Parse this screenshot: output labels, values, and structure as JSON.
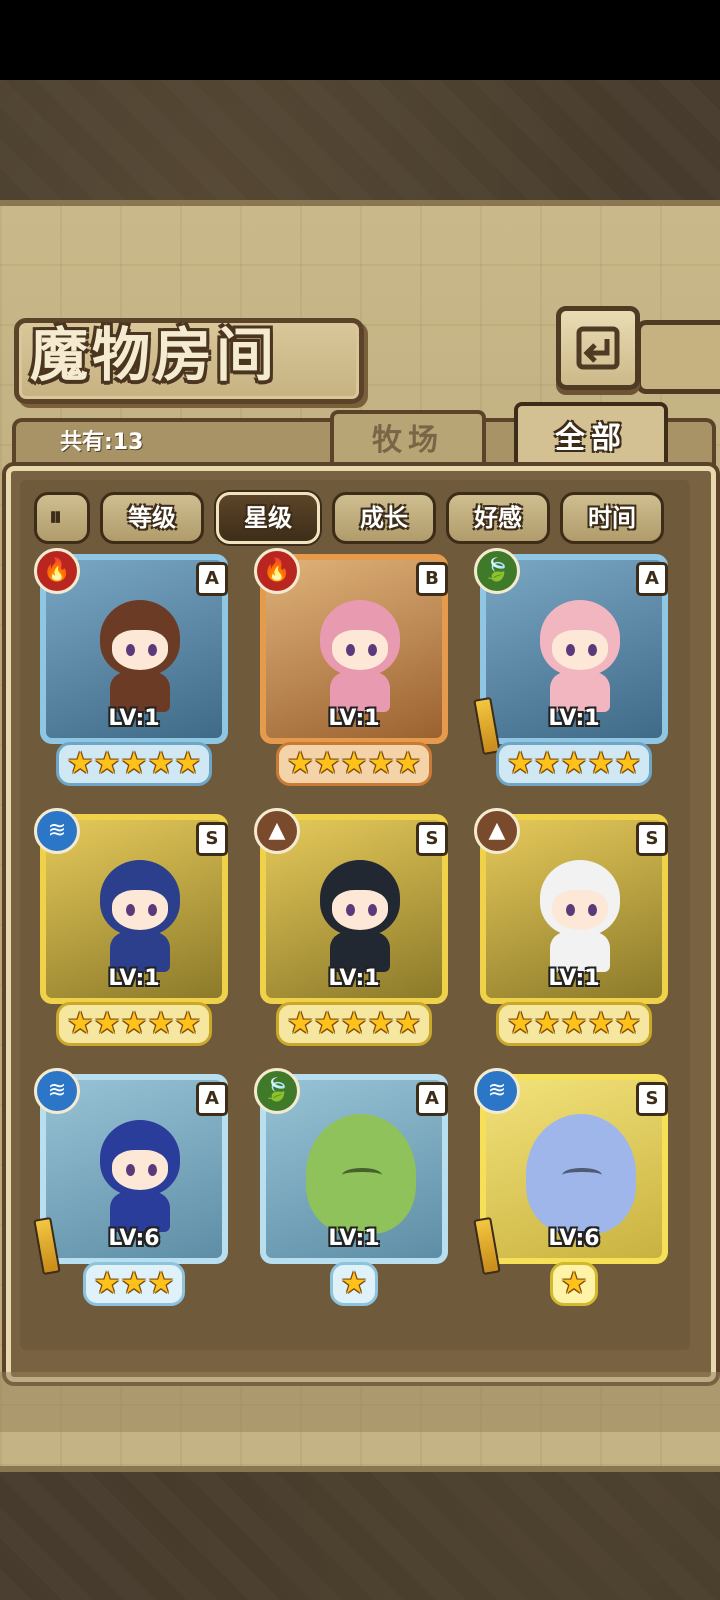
{
  "header": {
    "title": "魔物房间",
    "back_icon": "back-arrow-icon"
  },
  "tabs": {
    "count_label": "共有:13",
    "ranch": "牧场",
    "all": "全部",
    "active": "all"
  },
  "sort": {
    "toggle_icon": "sort-order-icon",
    "buttons": [
      "等级",
      "星级",
      "成长",
      "好感",
      "时间"
    ],
    "active": "星级"
  },
  "monsters": [
    {
      "element": "fire",
      "rank": "A",
      "level": "LV:1",
      "stars": 5,
      "frame": "blue"
    },
    {
      "element": "fire",
      "rank": "B",
      "level": "LV:1",
      "stars": 5,
      "frame": "orange"
    },
    {
      "element": "grass",
      "rank": "A",
      "level": "LV:1",
      "stars": 5,
      "frame": "blue"
    },
    {
      "element": "water",
      "rank": "S",
      "level": "LV:1",
      "stars": 5,
      "frame": "gold"
    },
    {
      "element": "earth",
      "rank": "S",
      "level": "LV:1",
      "stars": 5,
      "frame": "gold"
    },
    {
      "element": "earth",
      "rank": "S",
      "level": "LV:1",
      "stars": 5,
      "frame": "gold"
    },
    {
      "element": "water",
      "rank": "A",
      "level": "LV:6",
      "stars": 3,
      "frame": "lightblue"
    },
    {
      "element": "grass",
      "rank": "A",
      "level": "LV:1",
      "stars": 1,
      "frame": "lightblue"
    },
    {
      "element": "water",
      "rank": "S",
      "level": "LV:6",
      "stars": 1,
      "frame": "yellow"
    }
  ],
  "colors": {
    "star": "#ffc21a",
    "fire": "#b8261f",
    "water": "#2c76c7",
    "earth": "#7a4a2c",
    "grass": "#3f7a2a"
  }
}
